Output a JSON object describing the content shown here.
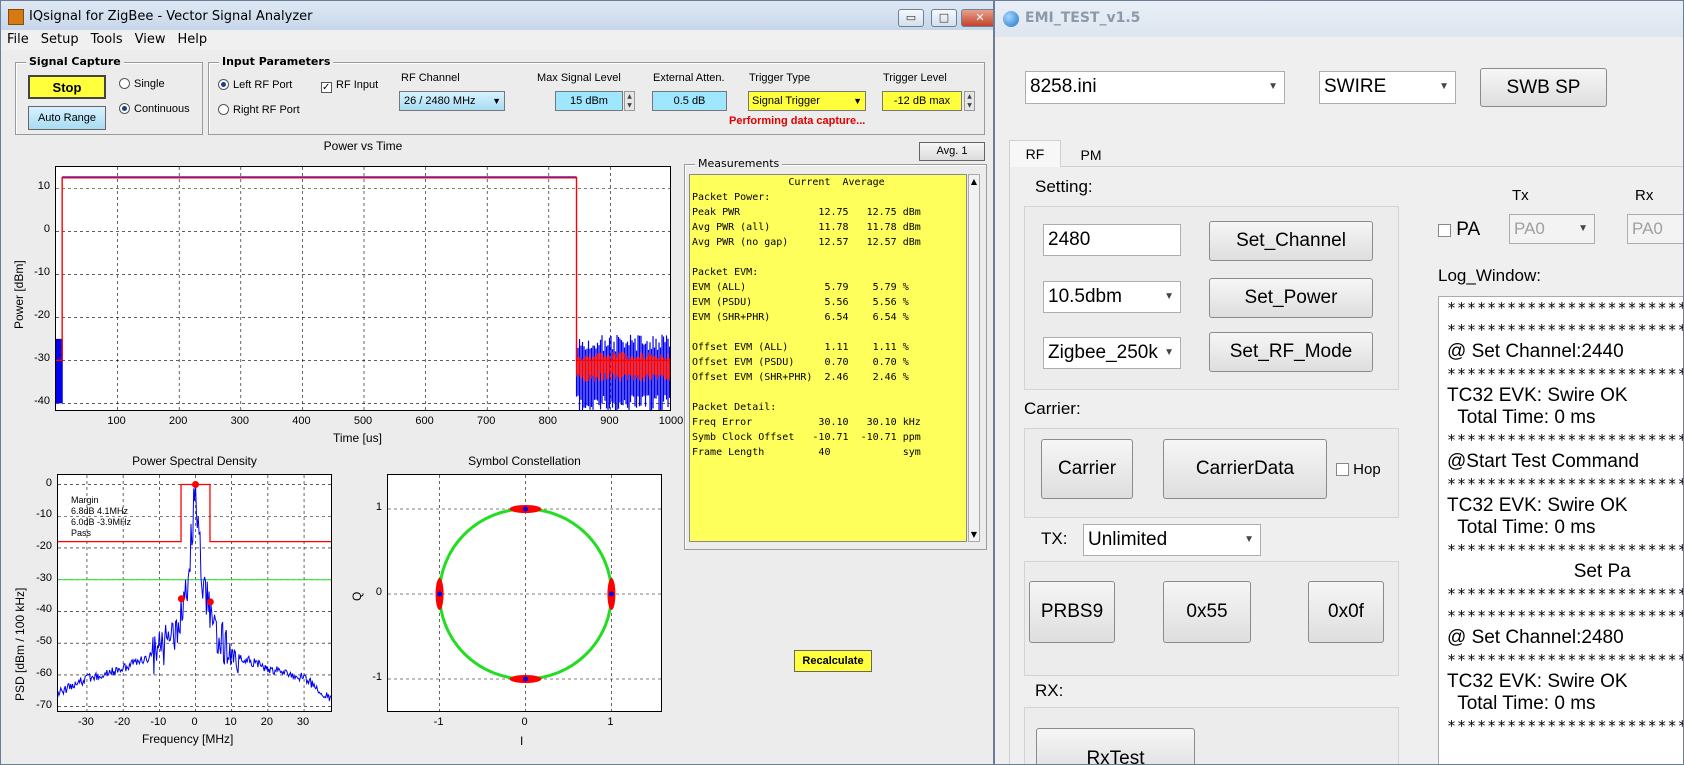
{
  "iq": {
    "title": "IQsignal for ZigBee - Vector Signal Analyzer",
    "win_buttons": {
      "minimize": "▭",
      "maximize": "□",
      "close": "✕"
    },
    "menu": [
      "File",
      "Setup",
      "Tools",
      "View",
      "Help"
    ],
    "signal_capture": {
      "label": "Signal Capture",
      "stop": "Stop",
      "auto_range": "Auto Range",
      "single": "Single",
      "continuous": "Continuous",
      "mode_selected": "Continuous"
    },
    "input_params": {
      "label": "Input Parameters",
      "left_port": "Left RF Port",
      "right_port": "Right RF Port",
      "port_selected": "Left RF Port",
      "rf_input": "RF Input",
      "rf_input_checked": true,
      "rf_channel_label": "RF Channel",
      "rf_channel_value": "26  /   2480 MHz",
      "max_level_label": "Max Signal Level",
      "max_level_value": "15 dBm",
      "ext_atten_label": "External Atten.",
      "ext_atten_value": "0.5 dB",
      "trigger_type_label": "Trigger Type",
      "trigger_type_value": "Signal Trigger",
      "trigger_level_label": "Trigger Level",
      "trigger_level_value": "-12 dB max",
      "status": "Performing data capture..."
    },
    "avg_button": "Avg. 1",
    "measurements": {
      "label": "Measurements",
      "rows": [
        "                Current  Average",
        "Packet Power:",
        "Peak PWR             12.75   12.75 dBm",
        "Avg PWR (all)        11.78   11.78 dBm",
        "Avg PWR (no gap)     12.57   12.57 dBm",
        "",
        "Packet EVM:",
        "EVM (ALL)             5.79    5.79 %",
        "EVM (PSDU)            5.56    5.56 %",
        "EVM (SHR+PHR)         6.54    6.54 %",
        "",
        "Offset EVM (ALL)      1.11    1.11 %",
        "Offset EVM (PSDU)     0.70    0.70 %",
        "Offset EVM (SHR+PHR)  2.46    2.46 %",
        "",
        "Packet Detail:",
        "Freq Error           30.10   30.10 kHz",
        "Symb Clock Offset   -10.71  -10.71 ppm",
        "Frame Length         40            sym"
      ]
    },
    "recalculate": "Recalculate",
    "colors": {
      "signal_red": "#ff0000",
      "signal_blue": "#0000ee",
      "constellation_green": "#22dd22",
      "highlight_yellow": "#ffff5c"
    }
  },
  "chart_data": [
    {
      "type": "line",
      "title": "Power vs Time",
      "xlabel": "Time [us]",
      "ylabel": "Power [dBm]",
      "xlim": [
        0,
        1000
      ],
      "ylim": [
        -42,
        15
      ],
      "xticks": [
        100,
        200,
        300,
        400,
        500,
        600,
        700,
        800,
        900,
        1000
      ],
      "yticks": [
        10,
        0,
        -10,
        -20,
        -30,
        -40
      ],
      "grid": true,
      "series": [
        {
          "x": [
            0,
            10,
            10,
            845,
            845,
            1000
          ],
          "y": [
            -30,
            -30,
            12.5,
            12.5,
            -30,
            -30
          ],
          "color": "#ff0000"
        }
      ]
    },
    {
      "type": "line",
      "title": "Power Spectral Density",
      "xlabel": "Frequency [MHz]",
      "ylabel": "PSD [dBm / 100 kHz]",
      "xlim": [
        -38,
        38
      ],
      "ylim": [
        -72,
        3
      ],
      "xticks": [
        -30,
        -20,
        -10,
        0,
        10,
        20,
        30
      ],
      "yticks": [
        0,
        -10,
        -20,
        -30,
        -40,
        -50,
        -60,
        -70
      ],
      "grid": true,
      "annotations": [
        "Margin",
        "6.8dB  4.1MHz",
        "6.0dB  -3.9MHz",
        "Pass"
      ],
      "mask": {
        "x": [
          -38,
          -4,
          -4,
          4,
          4,
          38
        ],
        "y": [
          -18,
          -18,
          0,
          0,
          -18,
          -18
        ]
      },
      "limit_line": -30,
      "series": [
        {
          "x": [
            -38,
            -30,
            -20,
            -10,
            -5,
            -2,
            -1,
            0,
            1,
            2,
            5,
            10,
            20,
            30,
            38
          ],
          "y": [
            -66,
            -61,
            -58,
            -53,
            -45,
            -30,
            -15,
            0,
            -15,
            -30,
            -45,
            -53,
            -58,
            -61,
            -68
          ],
          "color": "#0000ee"
        }
      ],
      "markers": [
        {
          "x": -3.9,
          "y": -36
        },
        {
          "x": 4.1,
          "y": -37
        },
        {
          "x": 0,
          "y": 0
        }
      ]
    },
    {
      "type": "scatter",
      "title": "Symbol Constellation",
      "xlabel": "I",
      "ylabel": "Q",
      "xlim": [
        -1.6,
        1.6
      ],
      "ylim": [
        -1.4,
        1.4
      ],
      "xticks": [
        -1,
        0,
        1
      ],
      "yticks": [
        1,
        0,
        -1
      ],
      "grid": true,
      "circle_radius": 1,
      "points": [
        {
          "x": 0,
          "y": 1
        },
        {
          "x": 0,
          "y": -1
        },
        {
          "x": 1,
          "y": 0
        },
        {
          "x": -1,
          "y": 0
        }
      ]
    }
  ],
  "emi": {
    "title": "EMI_TEST_v1.5",
    "ini_file": "8258.ini",
    "interface": "SWIRE",
    "swb_sp": "SWB SP",
    "tabs": [
      "RF",
      "PM"
    ],
    "active_tab": "RF",
    "setting_label": "Setting:",
    "channel_value": "2480",
    "set_channel": "Set_Channel",
    "power_value": "10.5dbm",
    "set_power": "Set_Power",
    "rf_mode_value": "Zigbee_250k",
    "set_rf_mode": "Set_RF_Mode",
    "carrier_label": "Carrier:",
    "carrier": "Carrier",
    "carrier_data": "CarrierData",
    "hop": "Hop",
    "tx_label": "TX:",
    "tx_value": "Unlimited",
    "prbs9": "PRBS9",
    "hex55": "0x55",
    "hex0f": "0x0f",
    "rx_label": "RX:",
    "rx_test": "RxTest",
    "pa": "PA",
    "tx_col": "Tx",
    "rx_col": "Rx",
    "tx_pa": "PA0",
    "rx_pa": "PA0",
    "log_label": "Log_Window:",
    "log": [
      "**********************************",
      "**********************************",
      "@ Set Channel:2440",
      "**********************************",
      "TC32 EVK: Swire OK",
      "  Total Time: 0 ms",
      "**********************************",
      "@Start Test Command",
      "**********************************",
      "TC32 EVK: Swire OK",
      "  Total Time: 0 ms",
      "**********************************",
      "                        Set Pa",
      "**********************************",
      "**********************************",
      "@ Set Channel:2480",
      "**********************************",
      "TC32 EVK: Swire OK",
      "  Total Time: 0 ms",
      "**********************************"
    ]
  }
}
